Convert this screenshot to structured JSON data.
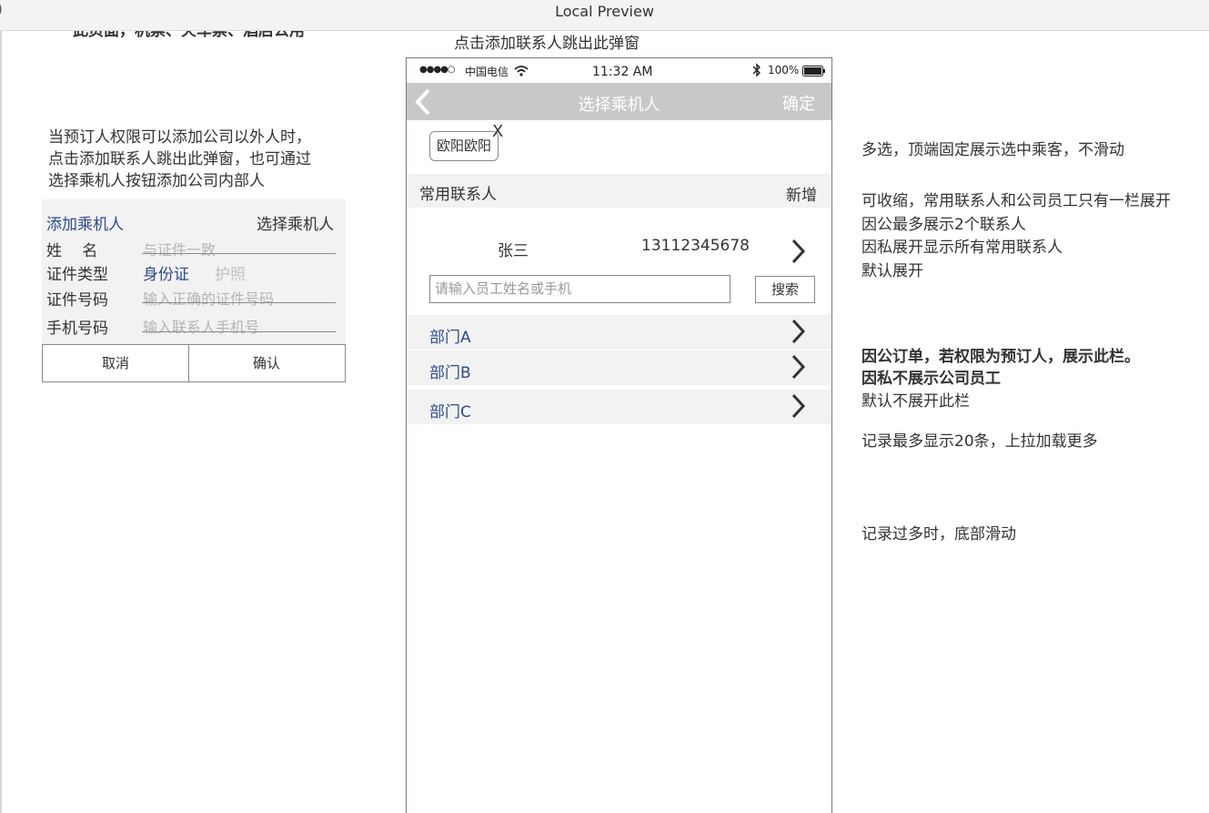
{
  "window": {
    "title": "Local Preview"
  },
  "notes": {
    "cut_top": "此页面，机票、火车票、酒店公用",
    "popup_hint": "点击添加联系人跳出此弹窗",
    "left_desc": [
      "当预订人权限可以添加公司以外人时，",
      "点击添加联系人跳出此弹窗，也可通过",
      "选择乘机人按钮添加公司内部人"
    ],
    "right_1": "多选，顶端固定展示选中乘客，不滑动",
    "right_2": [
      "可收缩，常用联系人和公司员工只有一栏展开",
      "因公最多展示2个联系人",
      "因私展开显示所有常用联系人",
      "默认展开"
    ],
    "right_3_bold": [
      "因公订单，若权限为预订人，展示此栏。",
      "因私不展示公司员工"
    ],
    "right_3_normal": "默认不展开此栏",
    "right_4": "记录最多显示20条，上拉加载更多",
    "right_5": "记录过多时，底部滑动"
  },
  "form": {
    "add_link": "添加乘机人",
    "select_link": "选择乘机人",
    "name_label": "姓　 名",
    "name_placeholder": "与证件一致",
    "id_type_label": "证件类型",
    "id_type_selected": "身份证",
    "id_type_other": "护照",
    "id_no_label": "证件号码",
    "id_no_placeholder": "输入正确的证件号码",
    "phone_label": "手机号码",
    "phone_placeholder": "输入联系人手机号",
    "cancel": "取消",
    "confirm": "确认"
  },
  "phone": {
    "status": {
      "signal": "●●●●○",
      "carrier": "中国电信",
      "time": "11:32  AM",
      "battery": "100%"
    },
    "nav": {
      "title": "选择乘机人",
      "confirm": "确定"
    },
    "selected_chip": "欧阳欧阳",
    "chip_close": "X",
    "contacts_header": "常用联系人",
    "contacts_add": "新增",
    "contact": {
      "name": "张三",
      "phone": "13112345678"
    },
    "search_placeholder": "请输入员工姓名或手机",
    "search_button": "搜索",
    "departments": [
      "部门A",
      "部门B",
      "部门C"
    ]
  },
  "colors": {
    "link_blue": "#2e4b8f",
    "nav_gray": "#c8c8c8",
    "panel_gray": "#f2f2f2"
  }
}
